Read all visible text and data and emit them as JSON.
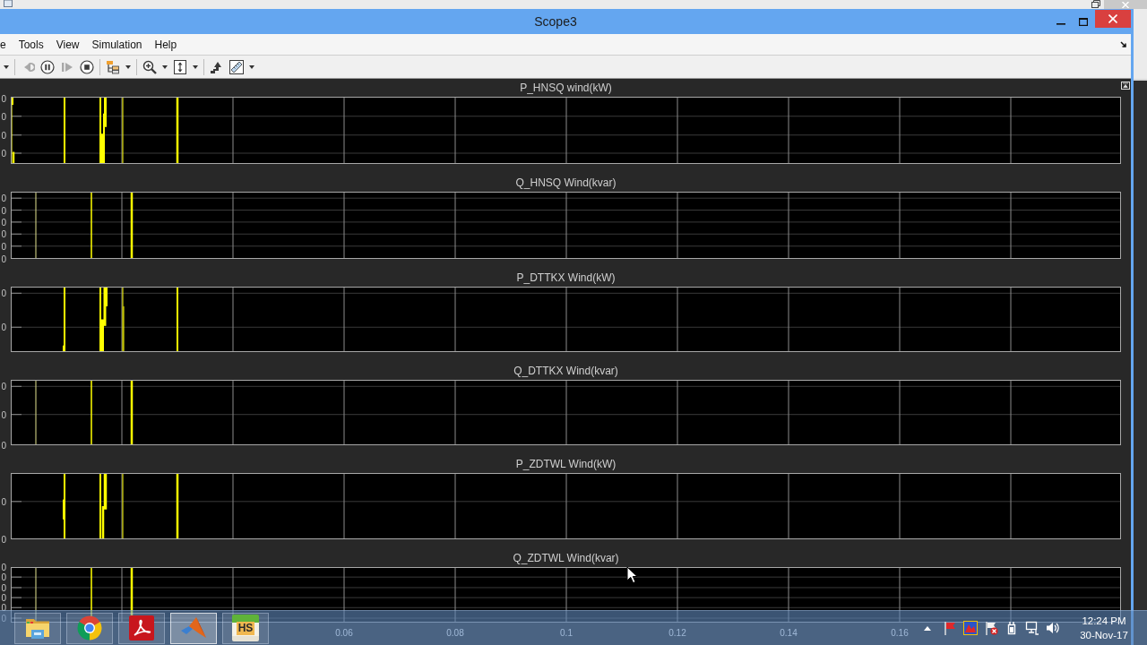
{
  "window": {
    "title": "Scope3"
  },
  "menu": [
    "e",
    "Tools",
    "View",
    "Simulation",
    "Help"
  ],
  "toolbar": [
    [
      {
        "kind": "caret",
        "disabled": false,
        "dropdown": false
      }
    ],
    [
      {
        "kind": "step-back",
        "disabled": true,
        "dropdown": false
      },
      {
        "kind": "pause",
        "disabled": false,
        "dropdown": false
      },
      {
        "kind": "step-forward",
        "disabled": true,
        "dropdown": false
      },
      {
        "kind": "stop",
        "disabled": false,
        "dropdown": false
      }
    ],
    [
      {
        "kind": "highlight",
        "disabled": false,
        "dropdown": true
      }
    ],
    [
      {
        "kind": "zoom",
        "disabled": false,
        "dropdown": true
      },
      {
        "kind": "fit",
        "disabled": false,
        "dropdown": true
      }
    ],
    [
      {
        "kind": "stair",
        "disabled": false,
        "dropdown": false
      },
      {
        "kind": "ruler",
        "disabled": false,
        "dropdown": true
      }
    ]
  ],
  "plots": [
    {
      "title": "P_HNSQ wind(kW)",
      "y_tick_labels": [
        "0",
        "0",
        "0",
        "0"
      ]
    },
    {
      "title": "Q_HNSQ Wind(kvar)",
      "y_tick_labels": [
        "0",
        "0",
        "0",
        "0",
        "0",
        "0"
      ]
    },
    {
      "title": "P_DTTKX Wind(kW)",
      "y_tick_labels": [
        "0",
        "0"
      ]
    },
    {
      "title": "Q_DTTKX Wind(kvar)",
      "y_tick_labels": [
        "0",
        "0",
        "0"
      ]
    },
    {
      "title": "P_ZDTWL Wind(kW)",
      "y_tick_labels": [
        "0",
        "0"
      ]
    },
    {
      "title": "Q_ZDTWL Wind(kvar)",
      "y_tick_labels": [
        "0",
        "0",
        "0",
        "0",
        "0",
        "0"
      ]
    }
  ],
  "x_tick_labels": [
    "0.06",
    "0.08",
    "0.1",
    "0.12",
    "0.14",
    "0.16"
  ],
  "taskbar": {
    "apps": [
      {
        "kind": "folder",
        "selected": false
      },
      {
        "kind": "browser",
        "selected": false
      },
      {
        "kind": "pdf",
        "selected": false
      },
      {
        "kind": "matlab",
        "selected": true
      },
      {
        "kind": "tile",
        "label": "HS",
        "selected": false
      }
    ],
    "clock": {
      "time": "12:24 PM",
      "date": "30-Nov-17"
    }
  }
}
